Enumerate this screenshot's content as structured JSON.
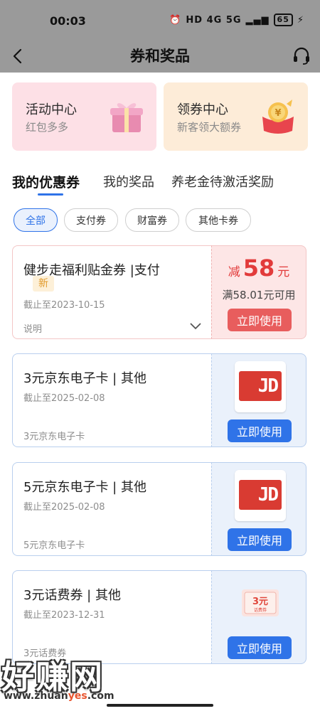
{
  "status_bar": {
    "time": "00:03",
    "signal_text": "HD 4G 5G",
    "battery": "65"
  },
  "header": {
    "title": "券和奖品"
  },
  "promo": [
    {
      "title": "活动中心",
      "subtitle": "红包多多"
    },
    {
      "title": "领券中心",
      "subtitle": "新客领大额券"
    }
  ],
  "tabs": [
    {
      "label": "我的优惠券",
      "active": true
    },
    {
      "label": "我的奖品",
      "active": false
    },
    {
      "label": "养老金待激活奖励",
      "active": false
    }
  ],
  "filters": [
    {
      "label": "全部",
      "active": true
    },
    {
      "label": "支付券",
      "active": false
    },
    {
      "label": "财富券",
      "active": false
    },
    {
      "label": "其他卡券",
      "active": false
    }
  ],
  "coupons": [
    {
      "title": "健步走福利贴金券 |支付",
      "badge": "新",
      "expiry": "截止至2023-10-15",
      "explain": "说明",
      "amount_prefix": "减",
      "amount": "58",
      "amount_unit": "元",
      "condition": "满58.01元可用",
      "button": "立即使用"
    },
    {
      "title": "3元京东电子卡 | 其他",
      "expiry": "截止至2025-02-08",
      "desc": "3元京东电子卡",
      "card_text": "JD",
      "button": "立即使用"
    },
    {
      "title": "5元京东电子卡 | 其他",
      "expiry": "截止至2025-02-08",
      "desc": "5元京东电子卡",
      "card_text": "JD",
      "button": "立即使用"
    },
    {
      "title": "3元话费券 | 其他",
      "expiry": "截止至2023-12-31",
      "desc": "3元话费券",
      "card_value": "3元",
      "card_label": "话费券",
      "button": "立即使用"
    }
  ],
  "watermark": {
    "brand": "好赚网",
    "url_prefix": "www.zhuan",
    "url_highlight": "yes",
    "url_suffix": ".com"
  },
  "colors": {
    "accent_blue": "#2f73e8",
    "accent_red": "#e85d5d",
    "status_bar_bg": "#9a9a9a"
  }
}
